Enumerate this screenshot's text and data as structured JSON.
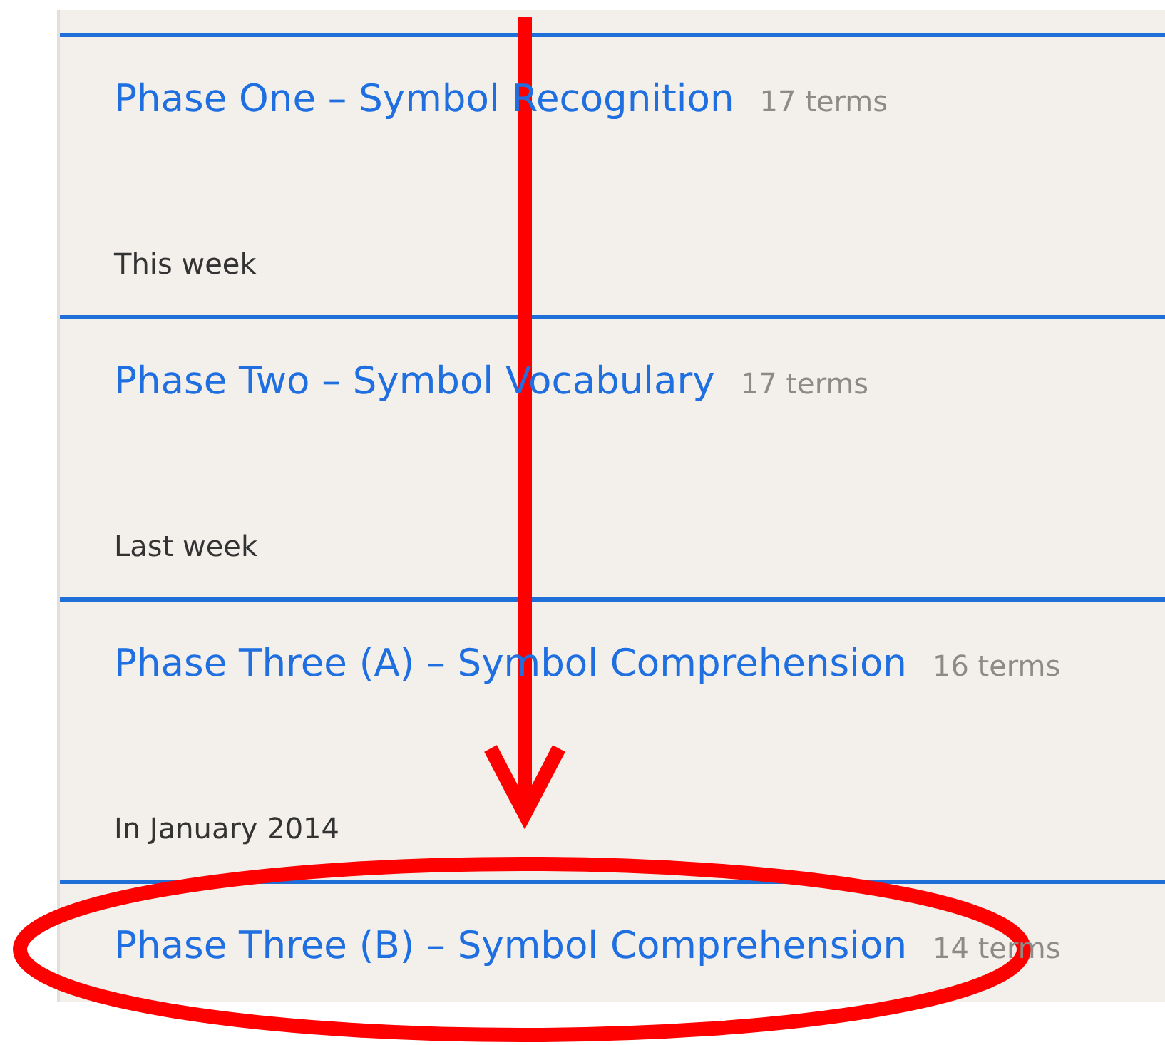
{
  "sets": [
    {
      "title": "Phase One – Symbol Recognition",
      "terms": "17 terms",
      "date": "This week",
      "highlighted": false
    },
    {
      "title": "Phase Two – Symbol Vocabulary",
      "terms": "17 terms",
      "date": "Last week",
      "highlighted": false
    },
    {
      "title": "Phase Three (A) – Symbol Comprehension",
      "terms": "16 terms",
      "date": "In January 2014",
      "highlighted": false
    },
    {
      "title": "Phase Three (B) – Symbol Comprehension",
      "terms": "14 terms",
      "highlighted": true
    }
  ]
}
